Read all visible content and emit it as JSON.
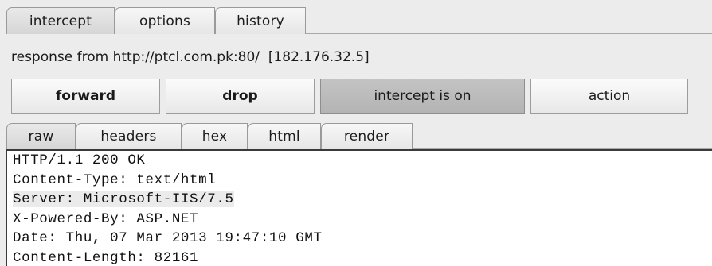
{
  "top_tabs": [
    {
      "label": "intercept"
    },
    {
      "label": "options"
    },
    {
      "label": "history"
    }
  ],
  "response_line": "response from http://ptcl.com.pk:80/  [182.176.32.5]",
  "buttons": {
    "forward": "forward",
    "drop": "drop",
    "intercept": "intercept is on",
    "action": "action"
  },
  "view_tabs": [
    {
      "label": "raw"
    },
    {
      "label": "headers"
    },
    {
      "label": "hex"
    },
    {
      "label": "html"
    },
    {
      "label": "render"
    }
  ],
  "raw_lines": [
    "HTTP/1.1 200 OK",
    "Content-Type: text/html",
    "Server: Microsoft-IIS/7.5",
    "X-Powered-By: ASP.NET",
    "Date: Thu, 07 Mar 2013 19:47:10 GMT",
    "Content-Length: 82161"
  ]
}
